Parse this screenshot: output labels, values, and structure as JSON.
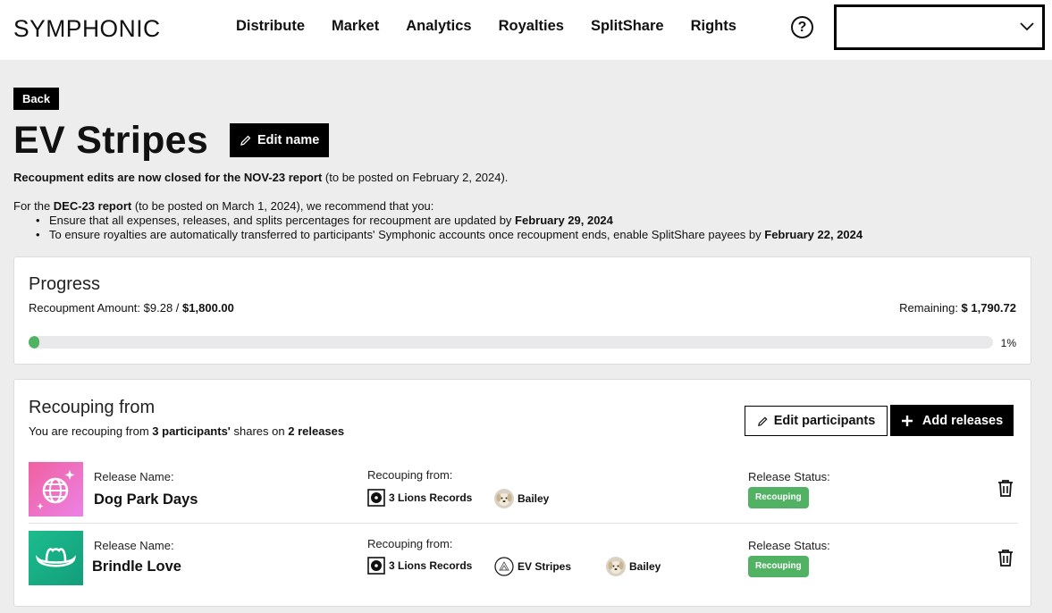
{
  "header": {
    "logo": "SYMPHONIC",
    "nav": [
      "Distribute",
      "Market",
      "Analytics",
      "Royalties",
      "SplitShare",
      "Rights"
    ],
    "help_label": "?"
  },
  "page": {
    "back_label": "Back",
    "title": "EV Stripes",
    "edit_name_label": "Edit name"
  },
  "notice": {
    "closed_bold": "Recoupment edits are now closed for the NOV-23 report",
    "closed_rest": " (to be posted on February 2, 2024).",
    "rec_prefix": "For the ",
    "rec_bold": "DEC-23 report",
    "rec_rest": " (to be posted on March 1, 2024), we recommend that you:",
    "bullet1_text": "Ensure that all expenses, releases, and splits percentages for recoupment are updated by ",
    "bullet1_date": "February 29, 2024",
    "bullet2_text": "To ensure royalties are automatically transferred to participants' Symphonic accounts once recoupment ends, enable SplitShare payees by ",
    "bullet2_date": "February 22, 2024"
  },
  "progress": {
    "title": "Progress",
    "amount_label": "Recoupment Amount: ",
    "amount_current": "$9.28",
    "amount_sep": " / ",
    "amount_total": "$1,800.00",
    "remaining_label": "Remaining: ",
    "remaining_value": "$ 1,790.72",
    "percent_label": "1%",
    "percent_value": 1
  },
  "recouping": {
    "title": "Recouping from",
    "sub_prefix": "You are recouping from ",
    "sub_participants": "3 participants'",
    "sub_mid": " shares on ",
    "sub_releases": "2 releases",
    "edit_participants_label": "Edit participants",
    "add_releases_label": "Add releases",
    "release_name_label": "Release Name:",
    "recouping_from_label": "Recouping from:",
    "status_label": "Release Status:",
    "releases": [
      {
        "name": "Dog Park Days",
        "participants": [
          "3 Lions Records",
          "Bailey"
        ],
        "status": "Recouping"
      },
      {
        "name": "Brindle Love",
        "participants": [
          "3 Lions Records",
          "EV Stripes",
          "Bailey"
        ],
        "status": "Recouping"
      }
    ]
  },
  "colors": {
    "accent_green": "#52b264",
    "thumb1_gradient": [
      "#f06bb4",
      "#e879e0"
    ],
    "thumb2_gradient": [
      "#1fb88a",
      "#14a07a"
    ]
  }
}
